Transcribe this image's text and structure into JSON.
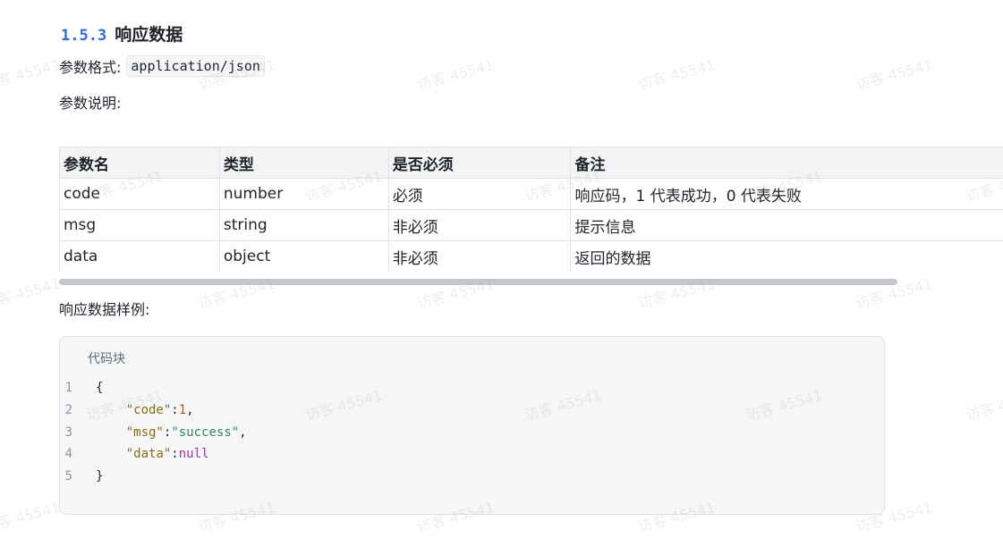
{
  "section": {
    "number": "1.5.3",
    "title": "响应数据"
  },
  "format": {
    "label": "参数格式:",
    "value": "application/json"
  },
  "description_label": "参数说明:",
  "table": {
    "headers": [
      "参数名",
      "类型",
      "是否必须",
      "备注"
    ],
    "rows": [
      [
        "code",
        "number",
        "必须",
        "响应码，1 代表成功，0 代表失败"
      ],
      [
        "msg",
        "string",
        "非必须",
        "提示信息"
      ],
      [
        "data",
        "object",
        "非必须",
        "返回的数据"
      ]
    ]
  },
  "example_label": "响应数据样例:",
  "code_block": {
    "label": "代码块",
    "line_numbers": [
      "1",
      "2",
      "3",
      "4",
      "5"
    ],
    "lines": [
      [
        {
          "t": "p",
          "v": "{"
        }
      ],
      [
        {
          "t": "p",
          "v": "    "
        },
        {
          "t": "k",
          "v": "\"code\""
        },
        {
          "t": "p",
          "v": ":"
        },
        {
          "t": "n",
          "v": "1"
        },
        {
          "t": "p",
          "v": ","
        }
      ],
      [
        {
          "t": "p",
          "v": "    "
        },
        {
          "t": "k",
          "v": "\"msg\""
        },
        {
          "t": "p",
          "v": ":"
        },
        {
          "t": "s",
          "v": "\"success\""
        },
        {
          "t": "p",
          "v": ","
        }
      ],
      [
        {
          "t": "p",
          "v": "    "
        },
        {
          "t": "k",
          "v": "\"data\""
        },
        {
          "t": "p",
          "v": ":"
        },
        {
          "t": "null",
          "v": "null"
        }
      ],
      [
        {
          "t": "p",
          "v": "}"
        }
      ]
    ]
  },
  "watermark": {
    "text": "访客 45541"
  },
  "colors": {
    "section_number": "#2b6ae6",
    "table_header_bg": "#f2f3f5",
    "code_bg": "#f5f6f7",
    "json_key": "#8a6d12",
    "json_number": "#b35c1e",
    "json_string": "#2e8b57",
    "json_null": "#a8329c"
  }
}
